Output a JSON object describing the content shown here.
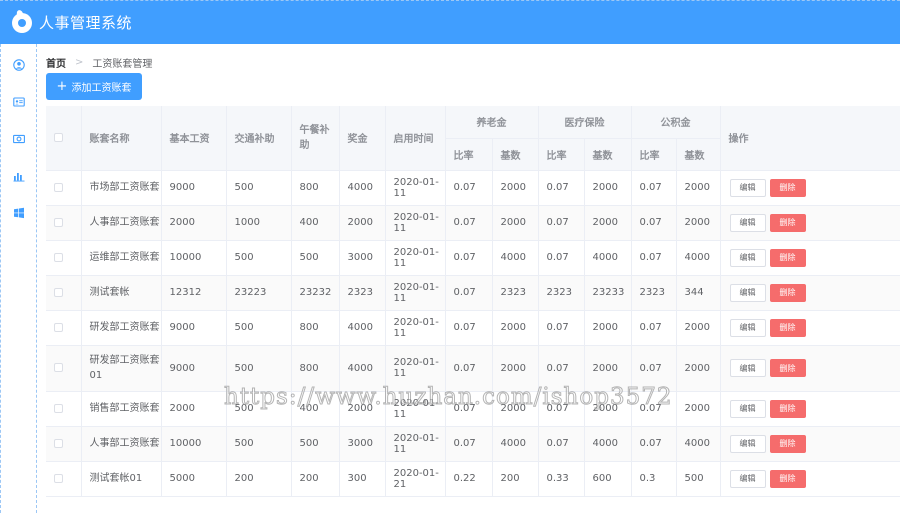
{
  "app": {
    "title": "人事管理系统"
  },
  "sidebar": {
    "items": [
      {
        "icon": "user-icon"
      },
      {
        "icon": "id-card-icon"
      },
      {
        "icon": "money-icon"
      },
      {
        "icon": "bar-chart-icon"
      },
      {
        "icon": "windows-icon"
      }
    ]
  },
  "breadcrumb": {
    "home": "首页",
    "separator": ">",
    "current": "工资账套管理"
  },
  "toolbar": {
    "add_label": "添加工资账套",
    "add_icon": "+"
  },
  "table": {
    "headers": {
      "name": "账套名称",
      "basic": "基本工资",
      "traffic": "交通补助",
      "lunch": "午餐补助",
      "bonus": "奖金",
      "start": "启用时间",
      "pension": "养老金",
      "medical": "医疗保险",
      "fund": "公积金",
      "rate": "比率",
      "base": "基数",
      "ops": "操作"
    },
    "edit_label": "编辑",
    "delete_label": "删除",
    "rows": [
      {
        "name": "市场部工资账套",
        "basic": "9000",
        "traffic": "500",
        "lunch": "800",
        "bonus": "4000",
        "start": "2020-01-11",
        "p_rate": "0.07",
        "p_base": "2000",
        "m_rate": "0.07",
        "m_base": "2000",
        "f_rate": "0.07",
        "f_base": "2000"
      },
      {
        "name": "人事部工资账套",
        "basic": "2000",
        "traffic": "1000",
        "lunch": "400",
        "bonus": "2000",
        "start": "2020-01-11",
        "p_rate": "0.07",
        "p_base": "2000",
        "m_rate": "0.07",
        "m_base": "2000",
        "f_rate": "0.07",
        "f_base": "2000"
      },
      {
        "name": "运维部工资账套",
        "basic": "10000",
        "traffic": "500",
        "lunch": "500",
        "bonus": "3000",
        "start": "2020-01-11",
        "p_rate": "0.07",
        "p_base": "4000",
        "m_rate": "0.07",
        "m_base": "4000",
        "f_rate": "0.07",
        "f_base": "4000"
      },
      {
        "name": "测试套帐",
        "basic": "12312",
        "traffic": "23223",
        "lunch": "23232",
        "bonus": "2323",
        "start": "2020-01-11",
        "p_rate": "0.07",
        "p_base": "2323",
        "m_rate": "2323",
        "m_base": "23233",
        "f_rate": "2323",
        "f_base": "344"
      },
      {
        "name": "研发部工资账套",
        "basic": "9000",
        "traffic": "500",
        "lunch": "800",
        "bonus": "4000",
        "start": "2020-01-11",
        "p_rate": "0.07",
        "p_base": "2000",
        "m_rate": "0.07",
        "m_base": "2000",
        "f_rate": "0.07",
        "f_base": "2000"
      },
      {
        "name": "研发部工资账套01",
        "basic": "9000",
        "traffic": "500",
        "lunch": "800",
        "bonus": "4000",
        "start": "2020-01-11",
        "p_rate": "0.07",
        "p_base": "2000",
        "m_rate": "0.07",
        "m_base": "2000",
        "f_rate": "0.07",
        "f_base": "2000"
      },
      {
        "name": "销售部工资账套",
        "basic": "2000",
        "traffic": "500",
        "lunch": "400",
        "bonus": "2000",
        "start": "2020-01-11",
        "p_rate": "0.07",
        "p_base": "2000",
        "m_rate": "0.07",
        "m_base": "2000",
        "f_rate": "0.07",
        "f_base": "2000"
      },
      {
        "name": "人事部工资账套",
        "basic": "10000",
        "traffic": "500",
        "lunch": "500",
        "bonus": "3000",
        "start": "2020-01-11",
        "p_rate": "0.07",
        "p_base": "4000",
        "m_rate": "0.07",
        "m_base": "4000",
        "f_rate": "0.07",
        "f_base": "4000"
      },
      {
        "name": "测试套帐01",
        "basic": "5000",
        "traffic": "200",
        "lunch": "200",
        "bonus": "300",
        "start": "2020-01-21",
        "p_rate": "0.22",
        "p_base": "200",
        "m_rate": "0.33",
        "m_base": "600",
        "f_rate": "0.3",
        "f_base": "500"
      }
    ]
  },
  "watermark": "https://www.huzhan.com/ishop3572"
}
